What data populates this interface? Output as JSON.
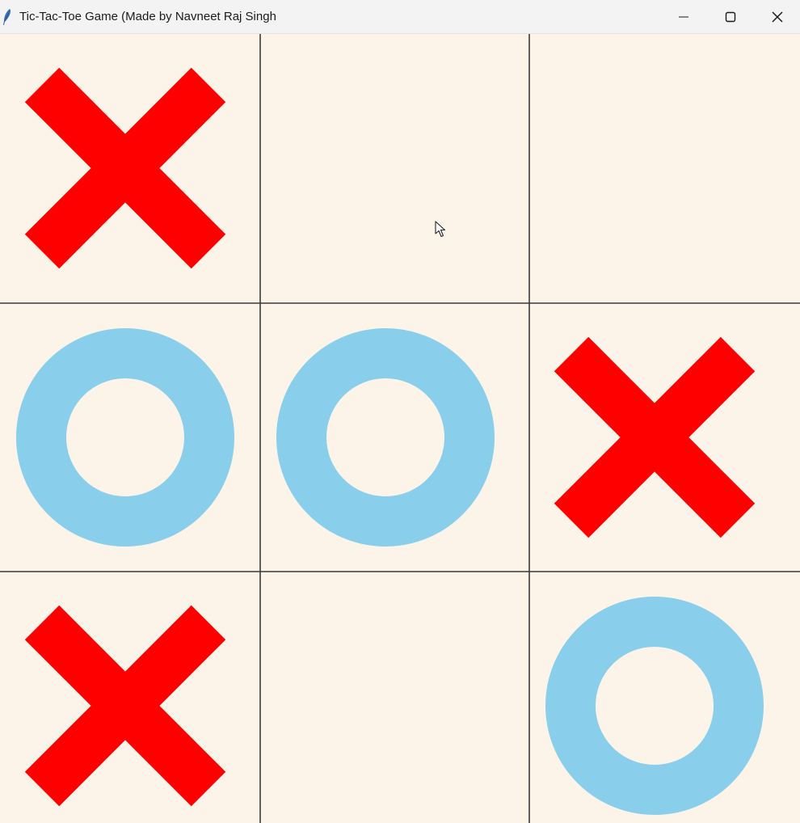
{
  "window": {
    "title": "Tic-Tac-Toe Game (Made by Navneet Raj Singh",
    "icon": "feather-icon",
    "controls": [
      "minimize-icon",
      "maximize-icon",
      "close-icon"
    ]
  },
  "board": {
    "background_color": "#fcf4e9",
    "grid_color": "#3a3a3a",
    "x_color": "#ff0000",
    "o_color": "#89ceeb",
    "cells": [
      [
        "X",
        "",
        ""
      ],
      [
        "O",
        "O",
        "X"
      ],
      [
        "X",
        "",
        "O"
      ]
    ]
  }
}
